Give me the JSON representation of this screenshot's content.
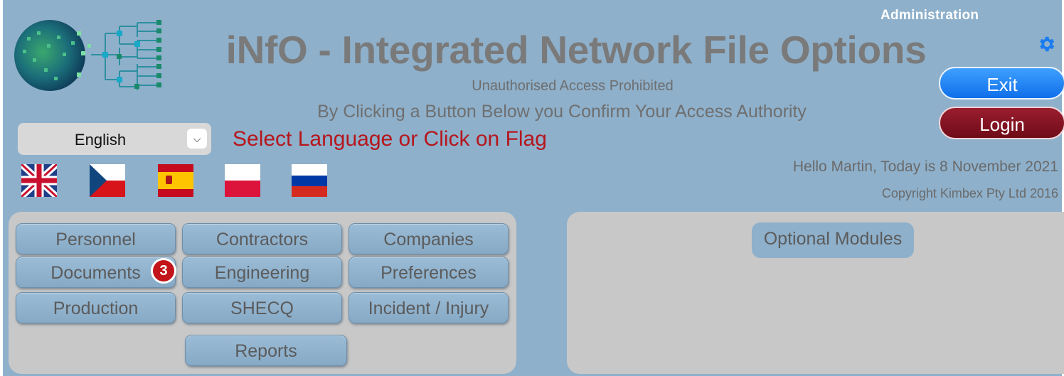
{
  "header": {
    "admin_label": "Administration",
    "title": "iNfO - Integrated Network File Options",
    "subtitle": "Unauthorised Access Prohibited",
    "confirm_text": "By Clicking a Button Below you Confirm Your Access Authority"
  },
  "auth": {
    "exit_label": "Exit",
    "login_label": "Login"
  },
  "language": {
    "selected": "English",
    "prompt": "Select Language or Click on Flag",
    "flags": [
      {
        "name": "uk-flag"
      },
      {
        "name": "czech-flag"
      },
      {
        "name": "spain-flag"
      },
      {
        "name": "poland-flag"
      },
      {
        "name": "russia-flag"
      }
    ]
  },
  "status": {
    "greeting": "Hello Martin, Today is 8 November 2021",
    "copyright": "Copyright Kimbex Pty Ltd 2016"
  },
  "modules": {
    "personnel": "Personnel",
    "contractors": "Contractors",
    "companies": "Companies",
    "documents": "Documents",
    "documents_badge": "3",
    "engineering": "Engineering",
    "preferences": "Preferences",
    "production": "Production",
    "shecq": "SHECQ",
    "incident": "Incident / Injury",
    "reports": "Reports"
  },
  "optional": {
    "label": "Optional Modules"
  },
  "colors": {
    "background": "#8eb0cb",
    "panel": "#c8c8c8",
    "title": "#7a7a7a",
    "prompt": "#b5161c",
    "exit": "#1a7cf0",
    "login": "#7d1221",
    "badge": "#c2141a",
    "gear": "#1a7cf0"
  },
  "icons": {
    "settings": "gear-icon",
    "dropdown": "chevron-down-icon",
    "logo": "network-globe-logo"
  }
}
